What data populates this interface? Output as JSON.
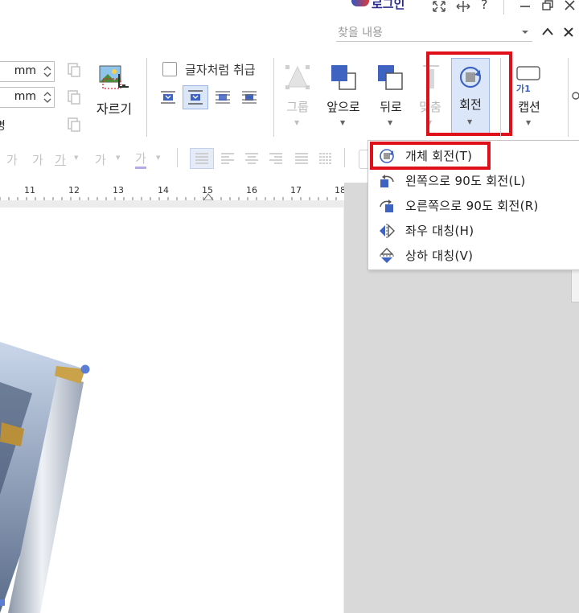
{
  "title_bar": {
    "login_label": "로그인",
    "help_label": "?"
  },
  "search": {
    "placeholder": "찾을 내용"
  },
  "size_group": {
    "width_unit": "mm",
    "height_unit": "mm",
    "partial_label": "명"
  },
  "crop": {
    "label": "자르기"
  },
  "wrap": {
    "checkbox_label": "글자처럼 취급"
  },
  "arrange": {
    "group_label": "그룹",
    "front_label": "앞으로",
    "back_label": "뒤로",
    "align_label": "맞춤",
    "rotate_label": "회전",
    "caption_label": "캡션",
    "caption_icon_text": "가1"
  },
  "format_bar": {
    "glyph": "가",
    "glyph2": "가",
    "glyph3": "가",
    "glyph4": "가",
    "glyph5": "가"
  },
  "ruler": {
    "ticks": [
      "11",
      "12",
      "13",
      "14",
      "15",
      "16",
      "17",
      "18"
    ]
  },
  "rotate_menu": {
    "items": [
      {
        "label": "개체 회전(T)",
        "icon": "object-rotate-icon"
      },
      {
        "label": "왼쪽으로 90도 회전(L)",
        "icon": "rotate-left-90-icon"
      },
      {
        "label": "오른쪽으로 90도 회전(R)",
        "icon": "rotate-right-90-icon"
      },
      {
        "label": "좌우 대칭(H)",
        "icon": "flip-horizontal-icon"
      },
      {
        "label": "상하 대칭(V)",
        "icon": "flip-vertical-icon"
      }
    ]
  },
  "colors": {
    "highlight": "#e0101a",
    "accent": "#3f63c0"
  }
}
